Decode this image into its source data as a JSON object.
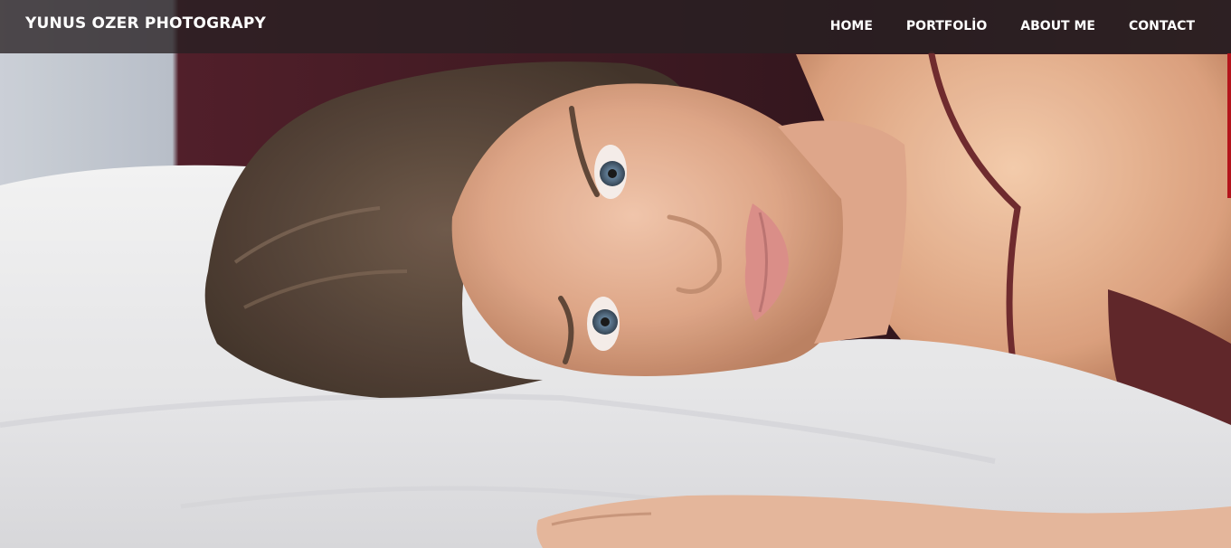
{
  "header": {
    "brand": "YUNUS OZER PHOTOGRAPY",
    "nav": [
      {
        "label": "HOME"
      },
      {
        "label": "PORTFOLİO"
      },
      {
        "label": "ABOUT ME"
      },
      {
        "label": "CONTACT"
      }
    ]
  },
  "hero": {
    "image": "woman-on-pillow-photo"
  },
  "colors": {
    "header_bg": "#282022",
    "accent": "#b3141b",
    "text": "#ffffff"
  }
}
